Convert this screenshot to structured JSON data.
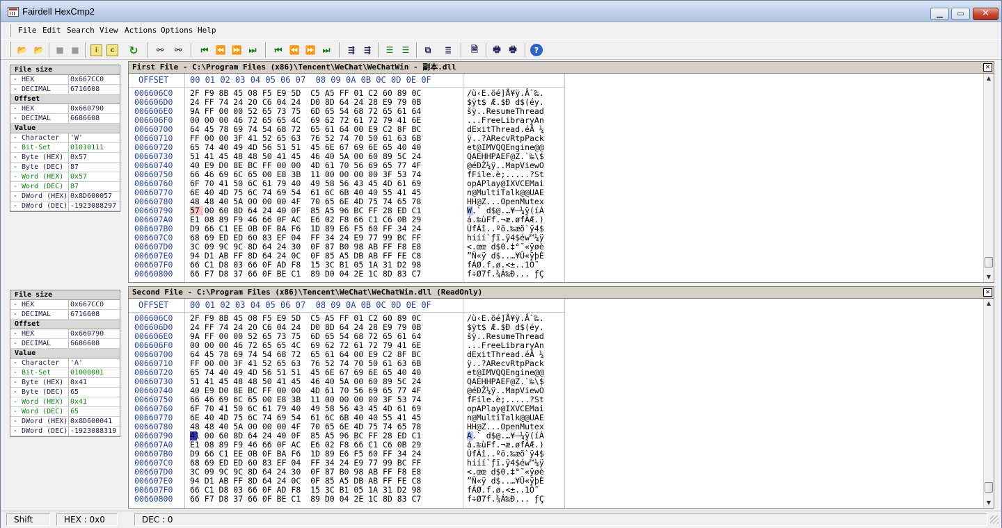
{
  "window": {
    "title": "Fairdell HexCmp2"
  },
  "menu": [
    "File",
    "Edit",
    "Search",
    "View",
    "Actions",
    "Options",
    "Help"
  ],
  "toolbar": {
    "buttons": [
      "open-file-1-icon",
      "open-file-2-icon",
      "disabled-icon",
      "disabled-icon",
      "info-icon",
      "copy-icon",
      "refresh-icon",
      "find-icon",
      "find-next-icon",
      "first-diff-icon",
      "prev-diff-icon",
      "next-diff-icon",
      "last-diff-icon",
      "first-diff-icon",
      "prev-diff-icon",
      "next-diff-icon",
      "last-diff-icon",
      "sync-icon",
      "sync2-icon",
      "align-left-icon",
      "align-right-icon",
      "compare-icon",
      "list-icon",
      "doc-icon",
      "print-icon",
      "print-preview-icon",
      "help-icon"
    ]
  },
  "panes": [
    {
      "title": "First File - C:\\Program Files (x86)\\Tencent\\WeChat\\WeChatWin - 副本.dll",
      "info": [
        {
          "type": "head",
          "label": "File size"
        },
        {
          "label": "- HEX",
          "value": "0x667CC0",
          "color": "dark"
        },
        {
          "label": "- DECIMAL",
          "value": "6716608",
          "color": "dark"
        },
        {
          "type": "head",
          "label": "Offset"
        },
        {
          "label": "- HEX",
          "value": "0x660790",
          "color": "dark"
        },
        {
          "label": "- DECIMAL",
          "value": "6686608",
          "color": "dark"
        },
        {
          "type": "head",
          "label": "Value"
        },
        {
          "label": "- Character",
          "value": "'W'",
          "color": "dark"
        },
        {
          "label": "- Bit-Set",
          "value": "01010111",
          "color": "green"
        },
        {
          "label": "- Byte (HEX)",
          "value": "0x57",
          "color": "dark"
        },
        {
          "label": "- Byte (DEC)",
          "value": "87",
          "color": "dark"
        },
        {
          "label": "- Word (HEX)",
          "value": "0x57",
          "color": "green"
        },
        {
          "label": "- Word (DEC)",
          "value": "87",
          "color": "green"
        },
        {
          "label": "- DWord (HEX)",
          "value": "0x8D600057",
          "color": "dark"
        },
        {
          "label": "- DWord (DEC)",
          "value": "-1923088297",
          "color": "dark"
        }
      ],
      "highlight_row": 12,
      "highlight_style": "pink",
      "rows": [
        {
          "off": "006606C0",
          "hex": "2F F9 8B 45 08 F5 E9 5D  C5 A5 FF 01 C2 60 89 0C",
          "asc": "/ù‹E.õé]Å¥ÿ.Â`‰."
        },
        {
          "off": "006606D0",
          "hex": "24 FF 74 24 20 C6 04 24  D0 8D 64 24 28 E9 79 0B",
          "asc": "$ÿt$ Æ.$Ð d$(éy."
        },
        {
          "off": "006606E0",
          "hex": "9A FF 00 00 52 65 73 75  6D 65 54 68 72 65 61 64",
          "asc": "šÿ..ResumeThread"
        },
        {
          "off": "006606F0",
          "hex": "00 00 00 46 72 65 65 4C  69 62 72 61 72 79 41 6E",
          "asc": "...FreeLibraryAn"
        },
        {
          "off": "00660700",
          "hex": "64 45 78 69 74 54 68 72  65 61 64 00 E9 C2 8F BC",
          "asc": "dExitThread.éÂ ¼"
        },
        {
          "off": "00660710",
          "hex": "FF 00 00 3F 41 52 65 63  76 52 74 70 50 61 63 6B",
          "asc": "ÿ..?ARecvRtpPack"
        },
        {
          "off": "00660720",
          "hex": "65 74 40 49 4D 56 51 51  45 6E 67 69 6E 65 40 40",
          "asc": "et@IMVQQEngine@@"
        },
        {
          "off": "00660730",
          "hex": "51 41 45 48 48 50 41 45  46 40 5A 00 60 89 5C 24",
          "asc": "QAEHHPAEF@Z.`‰\\$"
        },
        {
          "off": "00660740",
          "hex": "40 E9 D0 8E BC FF 00 00  4D 61 70 56 69 65 77 4F",
          "asc": "@éÐŽ¼ÿ..MapViewO"
        },
        {
          "off": "00660750",
          "hex": "66 46 69 6C 65 00 E8 3B  11 00 00 00 00 3F 53 74",
          "asc": "fFile.è;.....?St"
        },
        {
          "off": "00660760",
          "hex": "6F 70 41 50 6C 61 79 40  49 58 56 43 45 4D 61 69",
          "asc": "opAPlay@IXVCEMai"
        },
        {
          "off": "00660770",
          "hex": "6E 40 4D 75 6C 74 69 54  61 6C 6B 40 40 55 41 45",
          "asc": "n@MultiTalk@@UAE"
        },
        {
          "off": "00660780",
          "hex": "48 48 40 5A 00 00 00 4F  70 65 6E 4D 75 74 65 78",
          "asc": "HH@Z...OpenMutex"
        },
        {
          "off": "00660790",
          "hex": "57 00 60 8D 64 24 40 0F  85 A5 96 BC FF 28 ED C1",
          "asc": "W.` d$@.…¥–¼ÿ(íÁ"
        },
        {
          "off": "006607A0",
          "hex": "E1 08 89 F9 46 66 0F AC  E6 02 F8 66 C1 C6 0B 29",
          "asc": "á.‰ùFf.¬æ.øfÁÆ.)"
        },
        {
          "off": "006607B0",
          "hex": "D9 66 C1 EE 0B 0F BA F6  1D 89 E6 F5 60 FF 34 24",
          "asc": "ÙfÁî..ºö.‰æõ`ÿ4$"
        },
        {
          "off": "006607C0",
          "hex": "68 69 ED ED 60 83 EF 04  FF 34 24 E9 77 99 BC FF",
          "asc": "hiíí`ƒï.ÿ4$éw™¼ÿ"
        },
        {
          "off": "006607D0",
          "hex": "3C 09 9C 9C 8D 64 24 30  0F 87 B0 98 AB FF F8 E8",
          "asc": "<.œœ d$0.‡°˜«ÿøè"
        },
        {
          "off": "006607E0",
          "hex": "94 D1 AB FF 8D 64 24 0C  0F 85 A5 DB AB FF FE C8",
          "asc": "”Ñ«ÿ d$..…¥Û«ÿþÈ"
        },
        {
          "off": "006607F0",
          "hex": "66 C1 D8 03 66 0F AD F8  15 3C B1 05 1A 31 D2 98",
          "asc": "fÁØ.f.­ø.<±..1Ò˜"
        },
        {
          "off": "00660800",
          "hex": "66 F7 D8 37 66 0F BE C1  89 D0 04 2E 1C 8D 83 C7",
          "asc": "f÷Ø7f.¾Á‰Ð... ƒÇ"
        }
      ]
    },
    {
      "title": "Second File - C:\\Program Files (x86)\\Tencent\\WeChat\\WeChatWin.dll (ReadOnly)",
      "info": [
        {
          "type": "head",
          "label": "File size"
        },
        {
          "label": "- HEX",
          "value": "0x667CC0",
          "color": "dark"
        },
        {
          "label": "- DECIMAL",
          "value": "6716608",
          "color": "dark"
        },
        {
          "type": "head",
          "label": "Offset"
        },
        {
          "label": "- HEX",
          "value": "0x660790",
          "color": "dark"
        },
        {
          "label": "- DECIMAL",
          "value": "6686608",
          "color": "dark"
        },
        {
          "type": "head",
          "label": "Value"
        },
        {
          "label": "- Character",
          "value": "'A'",
          "color": "dark"
        },
        {
          "label": "- Bit-Set",
          "value": "01000001",
          "color": "green"
        },
        {
          "label": "- Byte (HEX)",
          "value": "0x41",
          "color": "dark"
        },
        {
          "label": "- Byte (DEC)",
          "value": "65",
          "color": "dark"
        },
        {
          "label": "- Word (HEX)",
          "value": "0x41",
          "color": "green"
        },
        {
          "label": "- Word (DEC)",
          "value": "65",
          "color": "green"
        },
        {
          "label": "- DWord (HEX)",
          "value": "0x8D600041",
          "color": "dark"
        },
        {
          "label": "- DWord (DEC)",
          "value": "-1923088319",
          "color": "dark"
        }
      ],
      "highlight_row": 12,
      "highlight_style": "blue",
      "rows": [
        {
          "off": "006606C0",
          "hex": "2F F9 8B 45 08 F5 E9 5D  C5 A5 FF 01 C2 60 89 0C",
          "asc": "/ù‹E.õé]Å¥ÿ.Â`‰."
        },
        {
          "off": "006606D0",
          "hex": "24 FF 74 24 20 C6 04 24  D0 8D 64 24 28 E9 79 0B",
          "asc": "$ÿt$ Æ.$Ð d$(éy."
        },
        {
          "off": "006606E0",
          "hex": "9A FF 00 00 52 65 73 75  6D 65 54 68 72 65 61 64",
          "asc": "šÿ..ResumeThread"
        },
        {
          "off": "006606F0",
          "hex": "00 00 00 46 72 65 65 4C  69 62 72 61 72 79 41 6E",
          "asc": "...FreeLibraryAn"
        },
        {
          "off": "00660700",
          "hex": "64 45 78 69 74 54 68 72  65 61 64 00 E9 C2 8F BC",
          "asc": "dExitThread.éÂ ¼"
        },
        {
          "off": "00660710",
          "hex": "FF 00 00 3F 41 52 65 63  76 52 74 70 50 61 63 6B",
          "asc": "ÿ..?ARecvRtpPack"
        },
        {
          "off": "00660720",
          "hex": "65 74 40 49 4D 56 51 51  45 6E 67 69 6E 65 40 40",
          "asc": "et@IMVQQEngine@@"
        },
        {
          "off": "00660730",
          "hex": "51 41 45 48 48 50 41 45  46 40 5A 00 60 89 5C 24",
          "asc": "QAEHHPAEF@Z.`‰\\$"
        },
        {
          "off": "00660740",
          "hex": "40 E9 D0 8E BC FF 00 00  4D 61 70 56 69 65 77 4F",
          "asc": "@éÐŽ¼ÿ..MapViewO"
        },
        {
          "off": "00660750",
          "hex": "66 46 69 6C 65 00 E8 3B  11 00 00 00 00 3F 53 74",
          "asc": "fFile.è;.....?St"
        },
        {
          "off": "00660760",
          "hex": "6F 70 41 50 6C 61 79 40  49 58 56 43 45 4D 61 69",
          "asc": "opAPlay@IXVCEMai"
        },
        {
          "off": "00660770",
          "hex": "6E 40 4D 75 6C 74 69 54  61 6C 6B 40 40 55 41 45",
          "asc": "n@MultiTalk@@UAE"
        },
        {
          "off": "00660780",
          "hex": "48 48 40 5A 00 00 00 4F  70 65 6E 4D 75 74 65 78",
          "asc": "HH@Z...OpenMutex"
        },
        {
          "off": "00660790",
          "hex": "41 00 60 8D 64 24 40 0F  85 A5 96 BC FF 28 ED C1",
          "asc": "A.` d$@.…¥–¼ÿ(íÁ"
        },
        {
          "off": "006607A0",
          "hex": "E1 08 89 F9 46 66 0F AC  E6 02 F8 66 C1 C6 0B 29",
          "asc": "á.‰ùFf.¬æ.øfÁÆ.)"
        },
        {
          "off": "006607B0",
          "hex": "D9 66 C1 EE 0B 0F BA F6  1D 89 E6 F5 60 FF 34 24",
          "asc": "ÙfÁî..ºö.‰æõ`ÿ4$"
        },
        {
          "off": "006607C0",
          "hex": "68 69 ED ED 60 83 EF 04  FF 34 24 E9 77 99 BC FF",
          "asc": "hiíí`ƒï.ÿ4$éw™¼ÿ"
        },
        {
          "off": "006607D0",
          "hex": "3C 09 9C 9C 8D 64 24 30  0F 87 B0 98 AB FF F8 E8",
          "asc": "<.œœ d$0.‡°˜«ÿøè"
        },
        {
          "off": "006607E0",
          "hex": "94 D1 AB FF 8D 64 24 0C  0F 85 A5 DB AB FF FE C8",
          "asc": "”Ñ«ÿ d$..…¥Û«ÿþÈ"
        },
        {
          "off": "006607F0",
          "hex": "66 C1 D8 03 66 0F AD F8  15 3C B1 05 1A 31 D2 98",
          "asc": "fÁØ.f.­ø.<±..1Ò˜"
        },
        {
          "off": "00660800",
          "hex": "66 F7 D8 37 66 0F BE C1  89 D0 04 2E 1C 8D 83 C7",
          "asc": "f÷Ø7f.¾Á‰Ð... ƒÇ"
        }
      ]
    }
  ],
  "hex_header": {
    "offset": "OFFSET",
    "bytes": "00 01 02 03 04 05 06 07  08 09 0A 0B 0C 0D 0E 0F"
  },
  "status": {
    "mode": "Shift",
    "hex": "HEX : 0x0",
    "dec": "DEC : 0"
  }
}
